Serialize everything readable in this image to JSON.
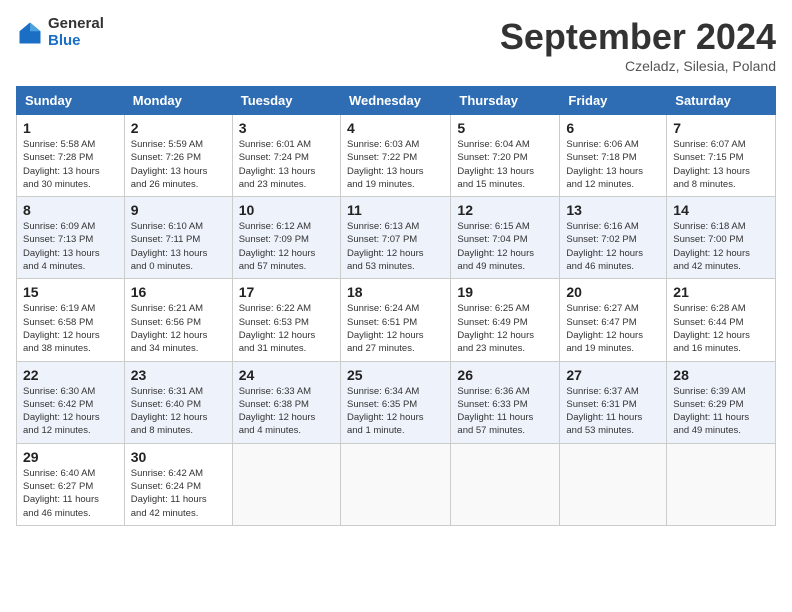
{
  "logo": {
    "general": "General",
    "blue": "Blue"
  },
  "title": "September 2024",
  "location": "Czeladz, Silesia, Poland",
  "days_header": [
    "Sunday",
    "Monday",
    "Tuesday",
    "Wednesday",
    "Thursday",
    "Friday",
    "Saturday"
  ],
  "weeks": [
    [
      {
        "day": "1",
        "info": "Sunrise: 5:58 AM\nSunset: 7:28 PM\nDaylight: 13 hours\nand 30 minutes."
      },
      {
        "day": "2",
        "info": "Sunrise: 5:59 AM\nSunset: 7:26 PM\nDaylight: 13 hours\nand 26 minutes."
      },
      {
        "day": "3",
        "info": "Sunrise: 6:01 AM\nSunset: 7:24 PM\nDaylight: 13 hours\nand 23 minutes."
      },
      {
        "day": "4",
        "info": "Sunrise: 6:03 AM\nSunset: 7:22 PM\nDaylight: 13 hours\nand 19 minutes."
      },
      {
        "day": "5",
        "info": "Sunrise: 6:04 AM\nSunset: 7:20 PM\nDaylight: 13 hours\nand 15 minutes."
      },
      {
        "day": "6",
        "info": "Sunrise: 6:06 AM\nSunset: 7:18 PM\nDaylight: 13 hours\nand 12 minutes."
      },
      {
        "day": "7",
        "info": "Sunrise: 6:07 AM\nSunset: 7:15 PM\nDaylight: 13 hours\nand 8 minutes."
      }
    ],
    [
      {
        "day": "8",
        "info": "Sunrise: 6:09 AM\nSunset: 7:13 PM\nDaylight: 13 hours\nand 4 minutes."
      },
      {
        "day": "9",
        "info": "Sunrise: 6:10 AM\nSunset: 7:11 PM\nDaylight: 13 hours\nand 0 minutes."
      },
      {
        "day": "10",
        "info": "Sunrise: 6:12 AM\nSunset: 7:09 PM\nDaylight: 12 hours\nand 57 minutes."
      },
      {
        "day": "11",
        "info": "Sunrise: 6:13 AM\nSunset: 7:07 PM\nDaylight: 12 hours\nand 53 minutes."
      },
      {
        "day": "12",
        "info": "Sunrise: 6:15 AM\nSunset: 7:04 PM\nDaylight: 12 hours\nand 49 minutes."
      },
      {
        "day": "13",
        "info": "Sunrise: 6:16 AM\nSunset: 7:02 PM\nDaylight: 12 hours\nand 46 minutes."
      },
      {
        "day": "14",
        "info": "Sunrise: 6:18 AM\nSunset: 7:00 PM\nDaylight: 12 hours\nand 42 minutes."
      }
    ],
    [
      {
        "day": "15",
        "info": "Sunrise: 6:19 AM\nSunset: 6:58 PM\nDaylight: 12 hours\nand 38 minutes."
      },
      {
        "day": "16",
        "info": "Sunrise: 6:21 AM\nSunset: 6:56 PM\nDaylight: 12 hours\nand 34 minutes."
      },
      {
        "day": "17",
        "info": "Sunrise: 6:22 AM\nSunset: 6:53 PM\nDaylight: 12 hours\nand 31 minutes."
      },
      {
        "day": "18",
        "info": "Sunrise: 6:24 AM\nSunset: 6:51 PM\nDaylight: 12 hours\nand 27 minutes."
      },
      {
        "day": "19",
        "info": "Sunrise: 6:25 AM\nSunset: 6:49 PM\nDaylight: 12 hours\nand 23 minutes."
      },
      {
        "day": "20",
        "info": "Sunrise: 6:27 AM\nSunset: 6:47 PM\nDaylight: 12 hours\nand 19 minutes."
      },
      {
        "day": "21",
        "info": "Sunrise: 6:28 AM\nSunset: 6:44 PM\nDaylight: 12 hours\nand 16 minutes."
      }
    ],
    [
      {
        "day": "22",
        "info": "Sunrise: 6:30 AM\nSunset: 6:42 PM\nDaylight: 12 hours\nand 12 minutes."
      },
      {
        "day": "23",
        "info": "Sunrise: 6:31 AM\nSunset: 6:40 PM\nDaylight: 12 hours\nand 8 minutes."
      },
      {
        "day": "24",
        "info": "Sunrise: 6:33 AM\nSunset: 6:38 PM\nDaylight: 12 hours\nand 4 minutes."
      },
      {
        "day": "25",
        "info": "Sunrise: 6:34 AM\nSunset: 6:35 PM\nDaylight: 12 hours\nand 1 minute."
      },
      {
        "day": "26",
        "info": "Sunrise: 6:36 AM\nSunset: 6:33 PM\nDaylight: 11 hours\nand 57 minutes."
      },
      {
        "day": "27",
        "info": "Sunrise: 6:37 AM\nSunset: 6:31 PM\nDaylight: 11 hours\nand 53 minutes."
      },
      {
        "day": "28",
        "info": "Sunrise: 6:39 AM\nSunset: 6:29 PM\nDaylight: 11 hours\nand 49 minutes."
      }
    ],
    [
      {
        "day": "29",
        "info": "Sunrise: 6:40 AM\nSunset: 6:27 PM\nDaylight: 11 hours\nand 46 minutes."
      },
      {
        "day": "30",
        "info": "Sunrise: 6:42 AM\nSunset: 6:24 PM\nDaylight: 11 hours\nand 42 minutes."
      },
      {
        "day": "",
        "info": ""
      },
      {
        "day": "",
        "info": ""
      },
      {
        "day": "",
        "info": ""
      },
      {
        "day": "",
        "info": ""
      },
      {
        "day": "",
        "info": ""
      }
    ]
  ]
}
